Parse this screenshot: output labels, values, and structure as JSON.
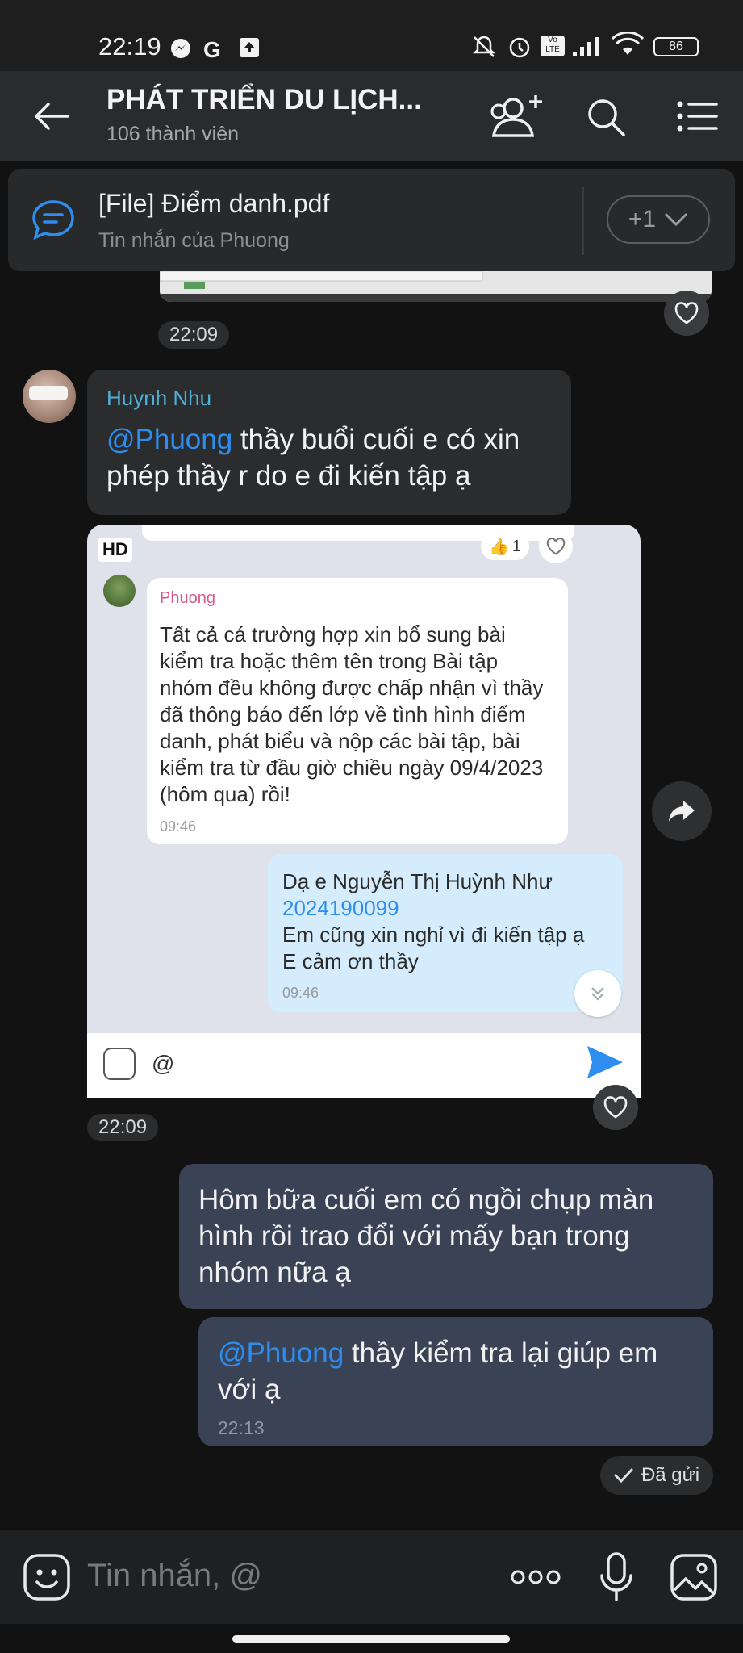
{
  "status": {
    "time": "22:19",
    "battery": "86"
  },
  "header": {
    "title": "PHÁT TRIỂN DU LỊCH...",
    "members": "106 thành viên"
  },
  "pinned": {
    "title": "[File] Điểm danh.pdf",
    "subtitle": "Tin nhắn của Phuong",
    "more": "+1"
  },
  "messages": {
    "time1": "22:09",
    "incoming": {
      "sender": "Huynh Nhu",
      "mention": "@Phuong",
      "text": " thầy buổi cuối e có xin phép thầy r do e đi kiến tập ạ"
    },
    "screenshot": {
      "hd": "HD",
      "reaction_count": "1",
      "inner_sender": "Phuong",
      "inner_text1": "Tất cả cá trường hợp xin bổ sung bài kiểm tra hoặc thêm tên trong Bài tập nhóm đều không được chấp nhận vì thầy đã thông báo đến lớp về tình hình điểm danh, phát biểu và nộp các bài tập, bài kiểm tra từ đầu giờ chiều ngày 09/4/2023 (hôm qua) rồi!",
      "inner_time1": "09:46",
      "inner_line1": "Dạ e Nguyễn Thị Huỳnh Như",
      "inner_id": "2024190099",
      "inner_line2": "Em cũng xin nghỉ vì đi kiến tập ạ",
      "inner_line3": "E cảm ơn thầy",
      "inner_time2": "09:46",
      "inner_input": "@"
    },
    "time2": "22:09",
    "outgoing1": "Hôm bữa cuối em có ngồi chụp màn hình rồi trao đổi với mấy bạn trong nhóm nữa ạ",
    "outgoing2": {
      "mention": "@Phuong",
      "text": " thầy kiểm tra lại giúp em với ạ",
      "time": "22:13"
    },
    "sent_label": "Đã gửi"
  },
  "composer": {
    "placeholder": "Tin nhắn, @"
  },
  "icons": [
    "back-arrow-icon",
    "add-member-icon",
    "search-icon",
    "menu-icon",
    "chat-icon",
    "chevron-down-icon",
    "heart-icon",
    "share-icon",
    "check-icon",
    "emoji-icon",
    "more-icon",
    "mic-icon",
    "image-icon",
    "send-icon"
  ]
}
